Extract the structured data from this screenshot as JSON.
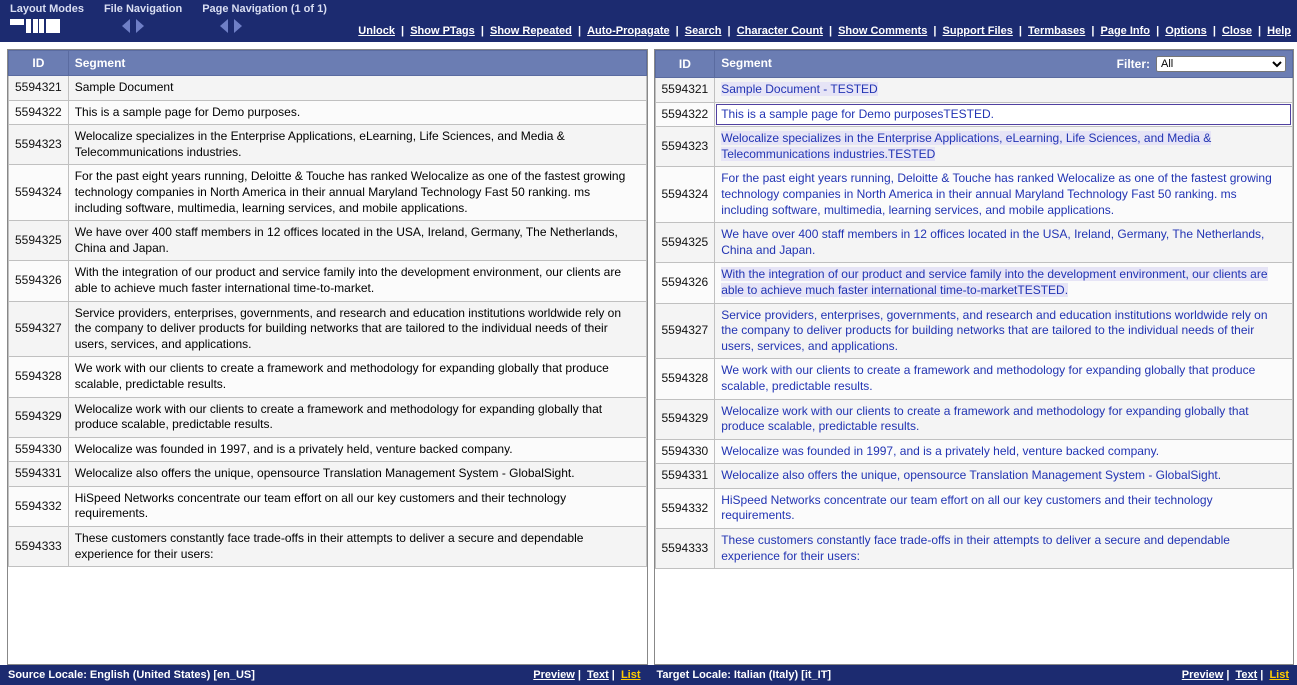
{
  "toolbar": {
    "layout_label": "Layout Modes",
    "file_nav_label": "File Navigation",
    "page_nav_label": "Page Navigation  (1 of 1)"
  },
  "toplinks": [
    "Unlock",
    "Show PTags",
    "Show Repeated",
    "Auto-Propagate",
    "Search",
    "Character Count",
    "Show Comments",
    "Support Files",
    "Termbases",
    "Page Info",
    "Options",
    "Close",
    "Help"
  ],
  "headers": {
    "id": "ID",
    "segment": "Segment",
    "filter_label": "Filter:",
    "filter_value": "All"
  },
  "source": {
    "locale_label": "Source Locale: English (United States) [en_US]",
    "segments": [
      {
        "id": "5594321",
        "text": "Sample Document"
      },
      {
        "id": "5594322",
        "text": "This is a sample page for Demo purposes."
      },
      {
        "id": "5594323",
        "text": "Welocalize specializes in the Enterprise Applications, eLearning, Life Sciences, and Media & Telecommunications industries."
      },
      {
        "id": "5594324",
        "text": "For the past eight years running, Deloitte & Touche has ranked Welocalize as one of the fastest growing technology companies in North America in their annual Maryland Technology Fast 50 ranking. ms including software, multimedia, learning services, and mobile applications."
      },
      {
        "id": "5594325",
        "text": "We have over 400 staff members in 12 offices located in the USA, Ireland, Germany, The Netherlands, China and Japan."
      },
      {
        "id": "5594326",
        "text": "With the integration of our product and service family into the development environment, our clients are able to achieve much faster international time-to-market."
      },
      {
        "id": "5594327",
        "text": "Service providers, enterprises, governments, and research and education institutions worldwide rely on the company to deliver products for building networks that are tailored to the individual needs of their users, services, and applications."
      },
      {
        "id": "5594328",
        "text": "We work with our clients to create a framework and methodology for expanding globally that produce scalable, predictable results."
      },
      {
        "id": "5594329",
        "text": "Welocalize work with our clients to create a framework and methodology for expanding globally that produce scalable, predictable results."
      },
      {
        "id": "5594330",
        "text": "Welocalize was founded in 1997, and is a privately held, venture backed company."
      },
      {
        "id": "5594331",
        "text": "Welocalize also offers the unique, opensource Translation Management System - GlobalSight."
      },
      {
        "id": "5594332",
        "text": "HiSpeed Networks concentrate our team effort on all our key customers and their technology requirements."
      },
      {
        "id": "5594333",
        "text": "These customers constantly face trade-offs in their attempts to deliver a secure and dependable experience for their users:"
      }
    ]
  },
  "target": {
    "locale_label": "Target Locale: Italian (Italy) [it_IT]",
    "segments": [
      {
        "id": "5594321",
        "text": "Sample Document - TESTED",
        "hl": true
      },
      {
        "id": "5594322",
        "text": "This is a sample page for Demo purposesTESTED.",
        "sel": true
      },
      {
        "id": "5594323",
        "text": "Welocalize specializes in the Enterprise Applications, eLearning, Life Sciences, and Media & Telecommunications industries.TESTED",
        "hl": true
      },
      {
        "id": "5594324",
        "text": "For the past eight years running, Deloitte & Touche has ranked Welocalize as one of the fastest growing technology companies in North America in their annual Maryland Technology Fast 50 ranking. ms including software, multimedia, learning services, and mobile applications."
      },
      {
        "id": "5594325",
        "text": "We have over 400 staff members in 12 offices located in the USA, Ireland, Germany, The Netherlands, China and Japan."
      },
      {
        "id": "5594326",
        "text": "With the integration of our product and service family into the development environment, our clients are able to achieve much faster international time-to-marketTESTED.",
        "hl": true
      },
      {
        "id": "5594327",
        "text": "Service providers, enterprises, governments, and research and education institutions worldwide rely on the company to deliver products for building networks that are tailored to the individual needs of their users, services, and applications."
      },
      {
        "id": "5594328",
        "text": "We work with our clients to create a framework and methodology for expanding globally that produce scalable, predictable results."
      },
      {
        "id": "5594329",
        "text": "Welocalize work with our clients to create a framework and methodology for expanding globally that produce scalable, predictable results."
      },
      {
        "id": "5594330",
        "text": "Welocalize was founded in 1997, and is a privately held, venture backed company."
      },
      {
        "id": "5594331",
        "text": "Welocalize also offers the unique, opensource Translation Management System - GlobalSight."
      },
      {
        "id": "5594332",
        "text": "HiSpeed Networks concentrate our team effort on all our key customers and their technology requirements."
      },
      {
        "id": "5594333",
        "text": "These customers constantly face trade-offs in their attempts to deliver a secure and dependable experience for their users:"
      }
    ]
  },
  "footer_links": {
    "preview": "Preview",
    "text": "Text",
    "list": "List"
  }
}
